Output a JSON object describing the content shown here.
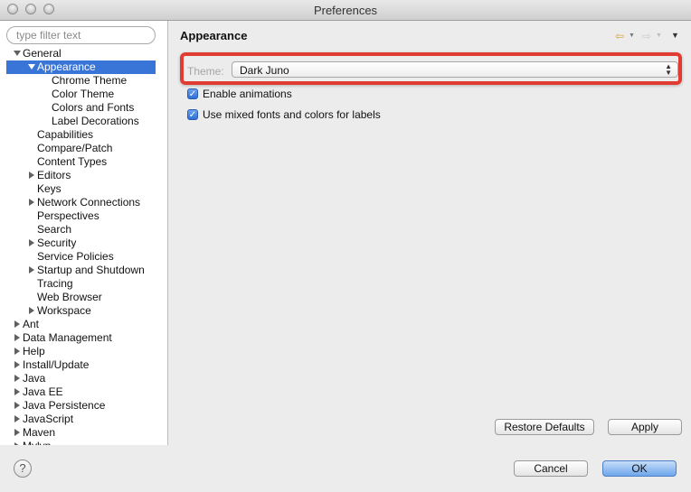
{
  "window": {
    "title": "Preferences"
  },
  "sidebar": {
    "filter_placeholder": "type filter text",
    "tree": [
      {
        "label": "General",
        "indent": 0,
        "twisty": "down"
      },
      {
        "label": "Appearance",
        "indent": 1,
        "twisty": "down",
        "selected": true
      },
      {
        "label": "Chrome Theme",
        "indent": 2,
        "twisty": "none"
      },
      {
        "label": "Color Theme",
        "indent": 2,
        "twisty": "none"
      },
      {
        "label": "Colors and Fonts",
        "indent": 2,
        "twisty": "none"
      },
      {
        "label": "Label Decorations",
        "indent": 2,
        "twisty": "none"
      },
      {
        "label": "Capabilities",
        "indent": 1,
        "twisty": "none"
      },
      {
        "label": "Compare/Patch",
        "indent": 1,
        "twisty": "none"
      },
      {
        "label": "Content Types",
        "indent": 1,
        "twisty": "none"
      },
      {
        "label": "Editors",
        "indent": 1,
        "twisty": "right"
      },
      {
        "label": "Keys",
        "indent": 1,
        "twisty": "none"
      },
      {
        "label": "Network Connections",
        "indent": 1,
        "twisty": "right"
      },
      {
        "label": "Perspectives",
        "indent": 1,
        "twisty": "none"
      },
      {
        "label": "Search",
        "indent": 1,
        "twisty": "none"
      },
      {
        "label": "Security",
        "indent": 1,
        "twisty": "right"
      },
      {
        "label": "Service Policies",
        "indent": 1,
        "twisty": "none"
      },
      {
        "label": "Startup and Shutdown",
        "indent": 1,
        "twisty": "right"
      },
      {
        "label": "Tracing",
        "indent": 1,
        "twisty": "none"
      },
      {
        "label": "Web Browser",
        "indent": 1,
        "twisty": "none"
      },
      {
        "label": "Workspace",
        "indent": 1,
        "twisty": "right"
      },
      {
        "label": "Ant",
        "indent": 0,
        "twisty": "right"
      },
      {
        "label": "Data Management",
        "indent": 0,
        "twisty": "right"
      },
      {
        "label": "Help",
        "indent": 0,
        "twisty": "right"
      },
      {
        "label": "Install/Update",
        "indent": 0,
        "twisty": "right"
      },
      {
        "label": "Java",
        "indent": 0,
        "twisty": "right"
      },
      {
        "label": "Java EE",
        "indent": 0,
        "twisty": "right"
      },
      {
        "label": "Java Persistence",
        "indent": 0,
        "twisty": "right"
      },
      {
        "label": "JavaScript",
        "indent": 0,
        "twisty": "right"
      },
      {
        "label": "Maven",
        "indent": 0,
        "twisty": "right"
      },
      {
        "label": "Mylyn",
        "indent": 0,
        "twisty": "right"
      }
    ]
  },
  "main": {
    "title": "Appearance",
    "theme_label": "Theme:",
    "theme_value": "Dark Juno",
    "options": [
      {
        "label": "Enable animations",
        "checked": true
      },
      {
        "label": "Use mixed fonts and colors for labels",
        "checked": true
      }
    ],
    "restore_defaults_label": "Restore Defaults",
    "apply_label": "Apply"
  },
  "footer": {
    "help_glyph": "?",
    "cancel_label": "Cancel",
    "ok_label": "OK"
  },
  "colors": {
    "selection": "#3875d7",
    "highlight_box": "#e03c32",
    "accent_button": "#6ea6ec"
  },
  "icons": [
    "back-icon",
    "forward-icon",
    "view-menu-icon",
    "help-icon",
    "close-window-icon",
    "minimize-window-icon",
    "zoom-window-icon"
  ]
}
